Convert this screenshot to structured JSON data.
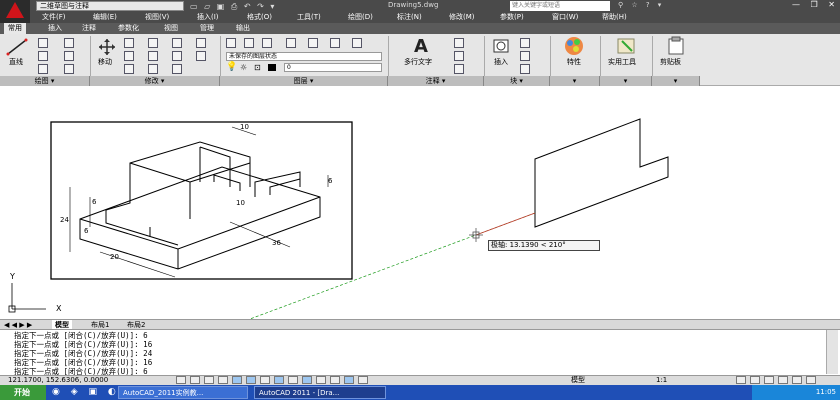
{
  "titlebar": {
    "workspace": "二维草图与注释",
    "document_title": "Drawing5.dwg",
    "search_placeholder": "键入关键字或短语",
    "window_controls": "— ❐ ✕"
  },
  "menu": [
    "文件(F)",
    "编辑(E)",
    "视图(V)",
    "插入(I)",
    "格式(O)",
    "工具(T)",
    "绘图(D)",
    "标注(N)",
    "修改(M)",
    "参数(P)",
    "窗口(W)",
    "帮助(H)"
  ],
  "ribbon_tabs": [
    "常用",
    "插入",
    "注释",
    "参数化",
    "视图",
    "管理",
    "输出"
  ],
  "ribbon": {
    "line_label": "直线",
    "move_label": "移动",
    "layer_state": "未保存的图层状态",
    "layer_value": "0",
    "multiline_text_label": "多行文字",
    "insert_label": "插入",
    "properties_label": "特性",
    "utilities_label": "实用工具",
    "clipboard_label": "剪贴板",
    "panel_draw": "绘图",
    "panel_modify": "修改",
    "panel_layers": "图层",
    "panel_annotation": "注释",
    "panel_block": "块"
  },
  "drawing": {
    "dims": [
      "10",
      "6",
      "16",
      "24",
      "6",
      "10",
      "20",
      "36",
      "24",
      "6"
    ],
    "ucs_x": "X",
    "ucs_y": "Y",
    "tooltip": "极轴: 13.1390 < 210°"
  },
  "layout_tabs": [
    "模型",
    "布局1",
    "布局2"
  ],
  "command_lines": [
    "指定下一点或 [闭合(C)/放弃(U)]: 6",
    "指定下一点或 [闭合(C)/放弃(U)]: 16",
    "指定下一点或 [闭合(C)/放弃(U)]: 24",
    "指定下一点或 [闭合(C)/放弃(U)]: 16",
    "指定下一点或 [闭合(C)/放弃(U)]: 6"
  ],
  "status": {
    "coordinates": "121.1700, 152.6306, 0.0000",
    "model": "模型",
    "scale": "1:1"
  },
  "taskbar": {
    "start": "开始",
    "tasks": [
      "AutoCAD_2011实例教...",
      "AutoCAD 2011 - [Dra..."
    ],
    "clock": "11:05"
  },
  "colors": {
    "brand_red": "#d0141a",
    "dark_chrome": "#4a4a4a",
    "ribbon_bg": "#e6e6e6",
    "taskbar": "#1f4fb6"
  }
}
